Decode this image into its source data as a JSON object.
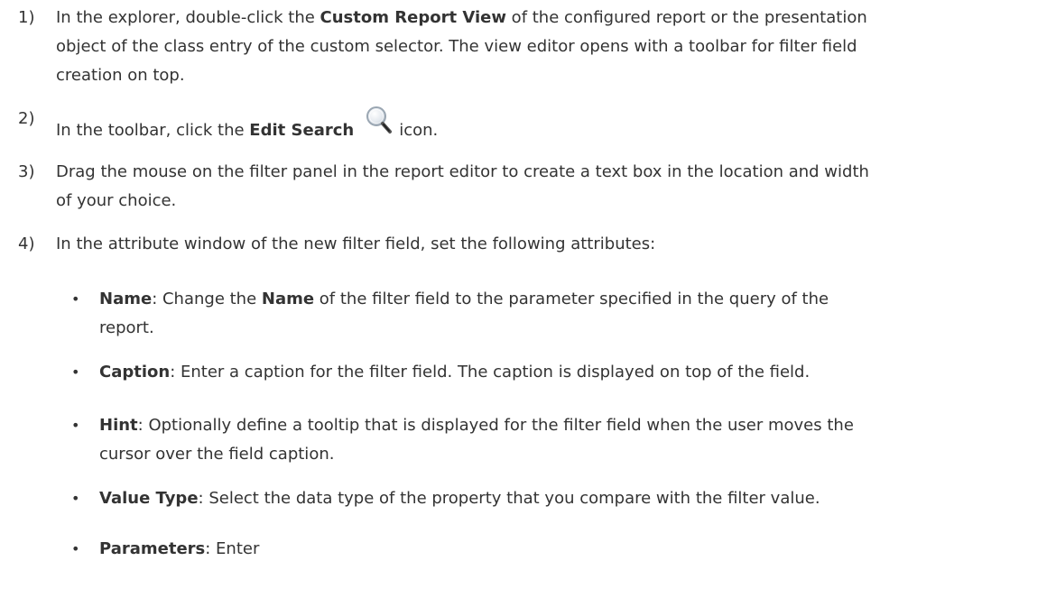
{
  "steps": [
    {
      "num": "1)",
      "l1_a": "In the explorer, double-click the ",
      "l1_b": "Custom Report View",
      "l1_c": " of the configured report or the presentation",
      "l2": "object of the class entry of the custom selector. The view editor opens with a toolbar for filter field",
      "l3": "creation on top."
    },
    {
      "num": "2)",
      "a": "In the toolbar, click the ",
      "b": "Edit Search",
      "c": "icon.",
      "icon": "magnifier-icon"
    },
    {
      "num": "3)",
      "l1": "Drag the mouse on the filter panel in the report editor to create a text box in the location and width",
      "l2": "of your choice."
    },
    {
      "num": "4)",
      "l1": "In the attribute window of the new filter field, set the following attributes:"
    }
  ],
  "bullets": [
    {
      "symbol": "•",
      "b1": "Name",
      "a1": ": Change the ",
      "b2": "Name",
      "a2": " of the filter field to the parameter specified in the query of the",
      "l2": "report."
    },
    {
      "symbol": "•",
      "b1": "Caption",
      "a1": ": Enter a caption for the filter field. The caption is displayed on top of the field."
    },
    {
      "symbol": "•",
      "b1": "Hint",
      "a1": ": Optionally define a tooltip that is displayed for the filter field when the user moves the",
      "l2": "cursor over the field caption."
    },
    {
      "symbol": "•",
      "b1": "Value Type",
      "a1": ": Select the data type of the property that you compare with the filter value."
    },
    {
      "symbol": "•",
      "b1": "Parameters",
      "a1": ": Enter"
    }
  ]
}
